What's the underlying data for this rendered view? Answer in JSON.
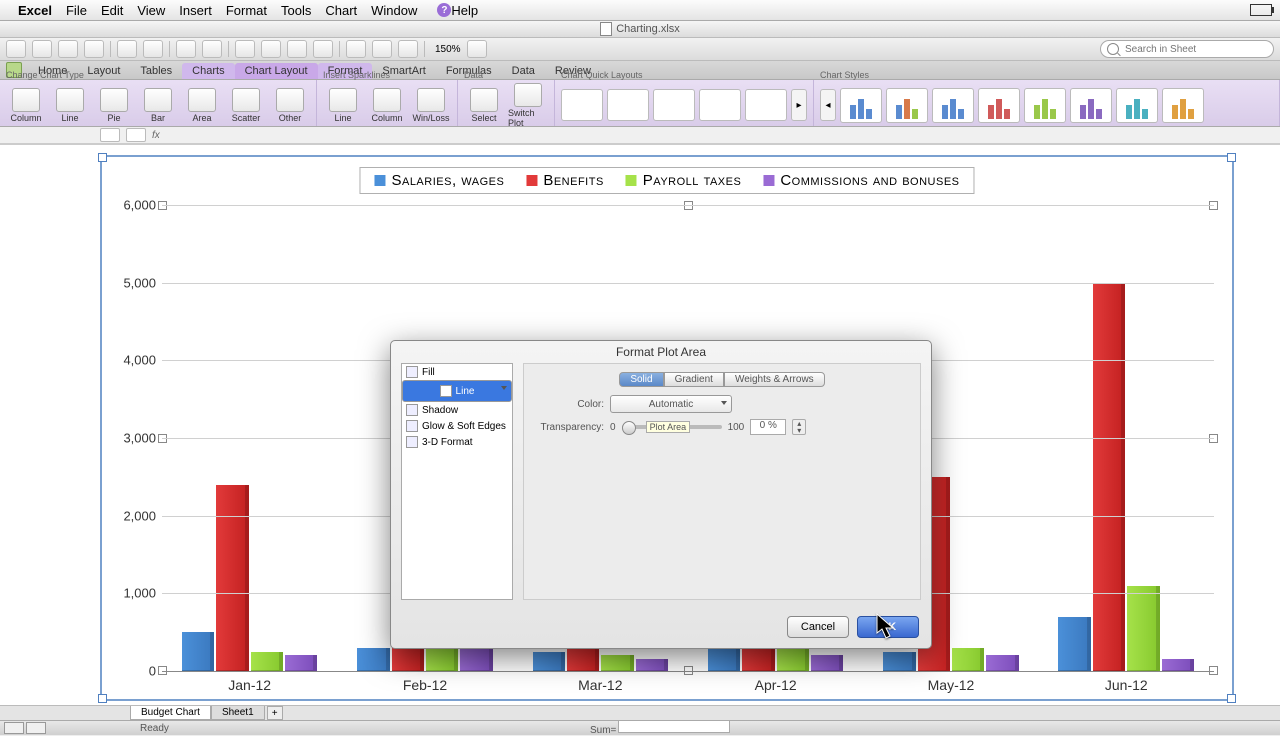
{
  "menubar": {
    "app": "Excel",
    "items": [
      "File",
      "Edit",
      "View",
      "Insert",
      "Format",
      "Tools",
      "Chart",
      "Window"
    ],
    "help": "Help"
  },
  "window": {
    "title": "Charting.xlsx"
  },
  "qat": {
    "zoom": "150%",
    "search_placeholder": "Search in Sheet"
  },
  "ribbon_tabs": [
    "Home",
    "Layout",
    "Tables",
    "Charts",
    "Chart Layout",
    "Format",
    "SmartArt",
    "Formulas",
    "Data",
    "Review"
  ],
  "ribbon_active": "Charts",
  "ribbon": {
    "group_chart_type": {
      "label": "Change Chart Type",
      "items": [
        "Column",
        "Line",
        "Pie",
        "Bar",
        "Area",
        "Scatter",
        "Other"
      ]
    },
    "group_sparklines": {
      "label": "Insert Sparklines",
      "items": [
        "Line",
        "Column",
        "Win/Loss"
      ]
    },
    "group_data": {
      "label": "Data",
      "items": [
        "Select",
        "Switch Plot"
      ]
    },
    "group_quick": {
      "label": "Chart Quick Layouts"
    },
    "group_styles": {
      "label": "Chart Styles"
    }
  },
  "formula_bar": {
    "fx": "fx"
  },
  "chart_data": {
    "type": "bar",
    "title": "",
    "ylim": [
      0,
      6000
    ],
    "yticks": [
      0,
      1000,
      2000,
      3000,
      4000,
      5000,
      6000
    ],
    "categories": [
      "Jan-12",
      "Feb-12",
      "Mar-12",
      "Apr-12",
      "May-12",
      "Jun-12"
    ],
    "series": [
      {
        "name": "Salaries, wages",
        "color": "#4b90d9",
        "values": [
          500,
          300,
          250,
          450,
          250,
          700
        ]
      },
      {
        "name": "Benefits",
        "color": "#e23a3a",
        "values": [
          2400,
          2400,
          2500,
          2650,
          2500,
          5000
        ]
      },
      {
        "name": "Payroll taxes",
        "color": "#a6e24a",
        "values": [
          250,
          300,
          200,
          1150,
          300,
          1100
        ]
      },
      {
        "name": "Commissions and bonuses",
        "color": "#9a6bd4",
        "values": [
          200,
          2200,
          150,
          200,
          200,
          150
        ]
      }
    ]
  },
  "dialog": {
    "title": "Format Plot Area",
    "side": [
      "Fill",
      "Line",
      "Shadow",
      "Glow & Soft Edges",
      "3-D Format"
    ],
    "side_selected": "Line",
    "tabs": [
      "Solid",
      "Gradient",
      "Weights & Arrows"
    ],
    "tab_selected": "Solid",
    "color_label": "Color:",
    "color_value": "Automatic",
    "trans_label": "Transparency:",
    "trans_min": "0",
    "trans_max": "100",
    "trans_value": "0 %",
    "tooltip": "Plot Area",
    "cancel": "Cancel",
    "ok": "OK"
  },
  "tabs": {
    "active": "Budget Chart",
    "others": [
      "Sheet1"
    ],
    "add": "+"
  },
  "status": {
    "ready": "Ready",
    "sum": "Sum="
  }
}
